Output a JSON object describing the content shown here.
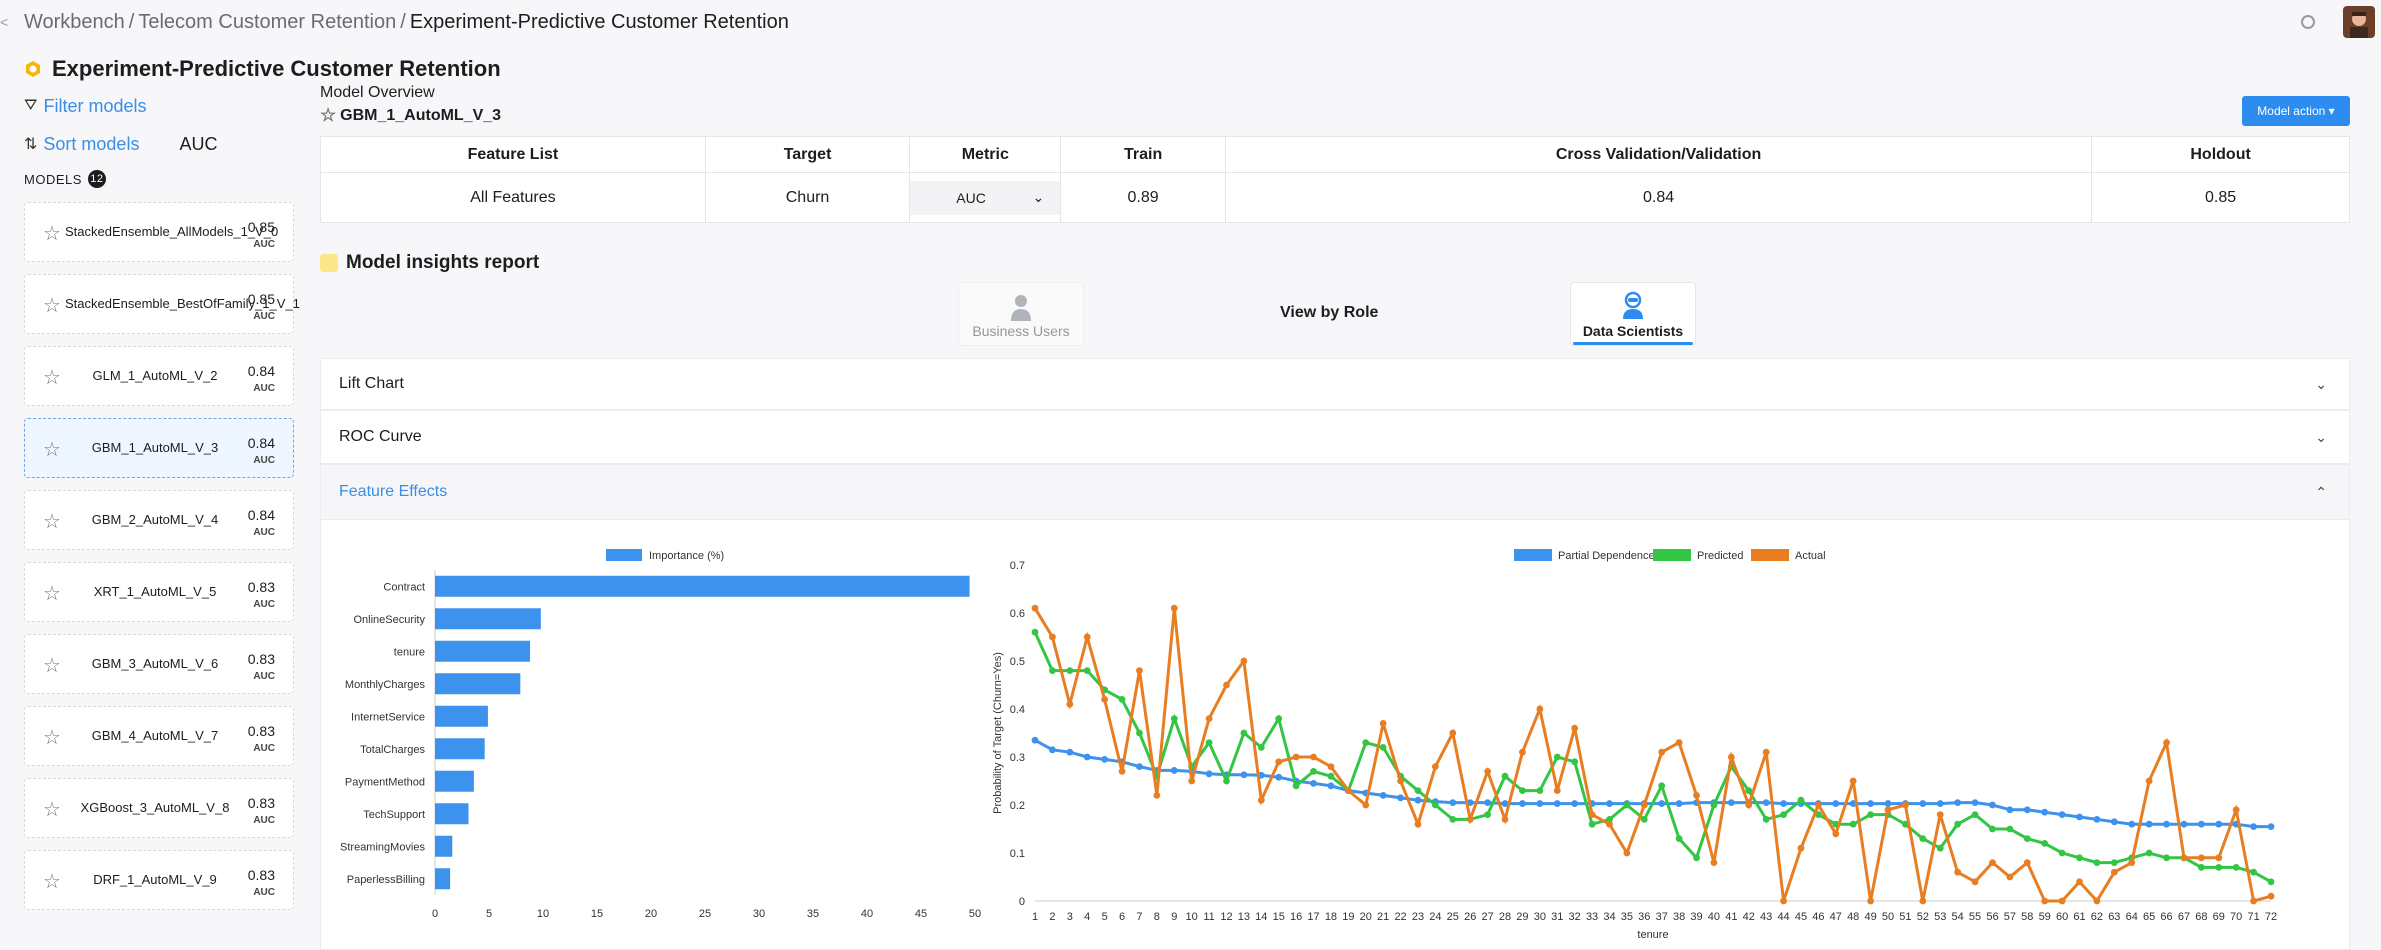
{
  "breadcrumb": {
    "back": "<",
    "items": [
      "Workbench",
      "Telecom Customer Retention",
      "Experiment-Predictive Customer Retention"
    ],
    "separator": "/"
  },
  "page_title": "Experiment-Predictive Customer Retention",
  "sidebar": {
    "filter_label": "Filter models",
    "sort_label": "Sort models",
    "sort_metric": "AUC",
    "models_header": "MODELS",
    "models_count": "12",
    "models": [
      {
        "name": "StackedEnsemble_AllModels_1_V_0",
        "score": "0.85",
        "metric": "AUC"
      },
      {
        "name": "StackedEnsemble_BestOfFamily_1_V_1",
        "score": "0.85",
        "metric": "AUC"
      },
      {
        "name": "GLM_1_AutoML_V_2",
        "score": "0.84",
        "metric": "AUC"
      },
      {
        "name": "GBM_1_AutoML_V_3",
        "score": "0.84",
        "metric": "AUC"
      },
      {
        "name": "GBM_2_AutoML_V_4",
        "score": "0.84",
        "metric": "AUC"
      },
      {
        "name": "XRT_1_AutoML_V_5",
        "score": "0.83",
        "metric": "AUC"
      },
      {
        "name": "GBM_3_AutoML_V_6",
        "score": "0.83",
        "metric": "AUC"
      },
      {
        "name": "GBM_4_AutoML_V_7",
        "score": "0.83",
        "metric": "AUC"
      },
      {
        "name": "XGBoost_3_AutoML_V_8",
        "score": "0.83",
        "metric": "AUC"
      },
      {
        "name": "DRF_1_AutoML_V_9",
        "score": "0.83",
        "metric": "AUC"
      }
    ],
    "selected_index": 3
  },
  "overview": {
    "label": "Model Overview",
    "model_name": "GBM_1_AutoML_V_3",
    "action_label": "Model action",
    "headers": [
      "Feature List",
      "Target",
      "Metric",
      "Train",
      "Cross Validation/Validation",
      "Holdout"
    ],
    "row": {
      "feature_list": "All Features",
      "target": "Churn",
      "metric": "AUC",
      "train": "0.89",
      "cv": "0.84",
      "holdout": "0.85"
    }
  },
  "insights": {
    "title": "Model insights report",
    "view_by": "View by Role",
    "roles": [
      "Business Users",
      "Data Scientists"
    ],
    "active_role": "Data Scientists"
  },
  "accordion": [
    "Lift Chart",
    "ROC Curve",
    "Feature Effects"
  ],
  "colors": {
    "accent": "#2d8cf0",
    "bar": "#3c92ec",
    "pd": "#3c92ec",
    "pred": "#33c544",
    "actual": "#e87d22"
  },
  "chart_data": [
    {
      "type": "bar",
      "orientation": "horizontal",
      "legend": [
        "Importance (%)"
      ],
      "categories": [
        "Contract",
        "OnlineSecurity",
        "tenure",
        "MonthlyCharges",
        "InternetService",
        "TotalCharges",
        "PaymentMethod",
        "TechSupport",
        "StreamingMovies",
        "PaperlessBilling"
      ],
      "values": [
        49.5,
        9.8,
        8.8,
        7.9,
        4.9,
        4.6,
        3.6,
        3.1,
        1.6,
        1.4
      ],
      "xlim": [
        0,
        50
      ],
      "xticks": [
        "0",
        "5",
        "10",
        "15",
        "20",
        "25",
        "30",
        "35",
        "40",
        "45",
        "50"
      ]
    },
    {
      "type": "line",
      "xlabel": "tenure",
      "ylabel": "Probability of Target (Churn=Yes)",
      "ylim": [
        0,
        0.7
      ],
      "yticks": [
        "0",
        "0.1",
        "0.2",
        "0.3",
        "0.4",
        "0.5",
        "0.6",
        "0.7"
      ],
      "x": [
        1,
        2,
        3,
        4,
        5,
        6,
        7,
        8,
        9,
        10,
        11,
        12,
        13,
        14,
        15,
        16,
        17,
        18,
        19,
        20,
        21,
        22,
        23,
        24,
        25,
        26,
        27,
        28,
        29,
        30,
        31,
        32,
        33,
        34,
        35,
        36,
        37,
        38,
        39,
        40,
        41,
        42,
        43,
        44,
        45,
        46,
        47,
        48,
        49,
        50,
        51,
        52,
        53,
        54,
        55,
        56,
        57,
        58,
        59,
        60,
        61,
        62,
        63,
        64,
        65,
        66,
        67,
        68,
        69,
        70,
        71,
        72
      ],
      "series": [
        {
          "name": "Partial Dependence",
          "values": [
            0.335,
            0.315,
            0.31,
            0.3,
            0.295,
            0.29,
            0.28,
            0.272,
            0.272,
            0.27,
            0.265,
            0.263,
            0.263,
            0.262,
            0.258,
            0.25,
            0.245,
            0.24,
            0.23,
            0.225,
            0.22,
            0.215,
            0.21,
            0.207,
            0.205,
            0.205,
            0.205,
            0.203,
            0.203,
            0.203,
            0.203,
            0.203,
            0.203,
            0.203,
            0.203,
            0.203,
            0.203,
            0.203,
            0.205,
            0.205,
            0.205,
            0.205,
            0.205,
            0.203,
            0.203,
            0.203,
            0.203,
            0.203,
            0.203,
            0.203,
            0.203,
            0.203,
            0.203,
            0.205,
            0.205,
            0.2,
            0.19,
            0.19,
            0.185,
            0.18,
            0.175,
            0.17,
            0.165,
            0.16,
            0.16,
            0.16,
            0.16,
            0.16,
            0.16,
            0.16,
            0.155,
            0.155
          ]
        },
        {
          "name": "Predicted",
          "values": [
            0.56,
            0.48,
            0.48,
            0.48,
            0.44,
            0.42,
            0.35,
            0.26,
            0.38,
            0.28,
            0.33,
            0.25,
            0.35,
            0.32,
            0.38,
            0.24,
            0.27,
            0.26,
            0.23,
            0.33,
            0.32,
            0.26,
            0.23,
            0.2,
            0.17,
            0.17,
            0.18,
            0.26,
            0.23,
            0.23,
            0.3,
            0.29,
            0.16,
            0.17,
            0.2,
            0.17,
            0.24,
            0.13,
            0.09,
            0.2,
            0.28,
            0.23,
            0.17,
            0.18,
            0.21,
            0.18,
            0.16,
            0.16,
            0.18,
            0.18,
            0.16,
            0.13,
            0.11,
            0.16,
            0.18,
            0.15,
            0.15,
            0.13,
            0.12,
            0.1,
            0.09,
            0.08,
            0.08,
            0.09,
            0.1,
            0.09,
            0.09,
            0.07,
            0.07,
            0.07,
            0.06,
            0.04
          ]
        },
        {
          "name": "Actual",
          "values": [
            0.61,
            0.55,
            0.41,
            0.55,
            0.42,
            0.27,
            0.48,
            0.22,
            0.61,
            0.25,
            0.38,
            0.45,
            0.5,
            0.21,
            0.29,
            0.3,
            0.3,
            0.28,
            0.23,
            0.2,
            0.37,
            0.25,
            0.16,
            0.28,
            0.35,
            0.17,
            0.27,
            0.17,
            0.31,
            0.4,
            0.23,
            0.36,
            0.18,
            0.16,
            0.1,
            0.2,
            0.31,
            0.33,
            0.22,
            0.08,
            0.3,
            0.2,
            0.31,
            0.0,
            0.11,
            0.2,
            0.14,
            0.25,
            0.0,
            0.19,
            0.2,
            0.0,
            0.18,
            0.06,
            0.04,
            0.08,
            0.05,
            0.08,
            0.0,
            0.0,
            0.04,
            0.0,
            0.06,
            0.08,
            0.25,
            0.33,
            0.09,
            0.09,
            0.09,
            0.19,
            0.0,
            0.01
          ]
        }
      ]
    }
  ]
}
